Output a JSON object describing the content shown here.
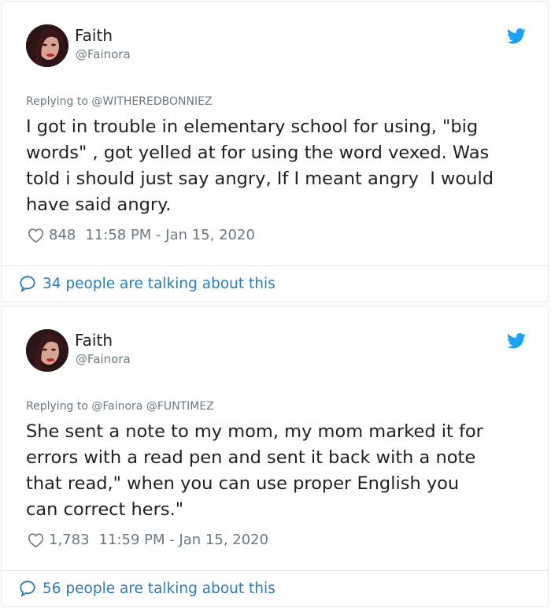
{
  "tweets": [
    {
      "name": "Faith",
      "handle": "@Fainora",
      "reply_to": "Replying to @WITHEREDBONNIEZ",
      "text": "I got in trouble in elementary school for using, \"big\nwords\" , got yelled at for using the word vexed. Was\ntold i should just say angry, If I meant angry  I would\nhave said angry.",
      "likes": "848",
      "timestamp": "11:58 PM - Jan 15, 2020",
      "talking": "34 people are talking about this"
    },
    {
      "name": "Faith",
      "handle": "@Fainora",
      "reply_to": "Replying to @Fainora @FUNTIMEZ",
      "text": "She sent a note to my mom, my mom marked it for\nerrors with a read pen and sent it back with a note\nthat read,\" when you can use proper English you\ncan correct hers.\"",
      "likes": "1,783",
      "timestamp": "11:59 PM - Jan 15, 2020",
      "talking": "56 people are talking about this"
    }
  ],
  "colors": {
    "link": "#2b7bb9",
    "twitter_blue": "#1da1f2",
    "muted": "#697882"
  },
  "icons": {
    "brand": "twitter-bird-icon",
    "like": "heart-icon",
    "reply": "speech-bubble-icon"
  }
}
